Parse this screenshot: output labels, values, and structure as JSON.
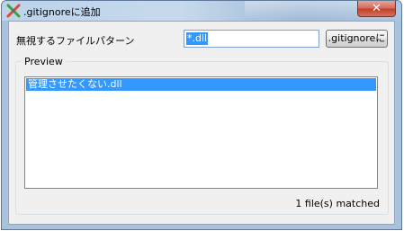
{
  "window": {
    "title": ".gitignoreに追加",
    "close_glyph": "✕"
  },
  "form": {
    "pattern_label": "無視するファイルパターン",
    "pattern_value": "*.dll",
    "add_button_label": ".gitignoreに"
  },
  "preview": {
    "label": "Preview",
    "items": [
      "管理させたくない.dll"
    ],
    "status": "1 file(s) matched"
  },
  "icons": {
    "app_icon": "git-extensions-icon",
    "close_icon": "close-icon"
  },
  "colors": {
    "selection": "#3399ff",
    "close_button": "#c2402c",
    "client_background": "#f0f0f0"
  }
}
